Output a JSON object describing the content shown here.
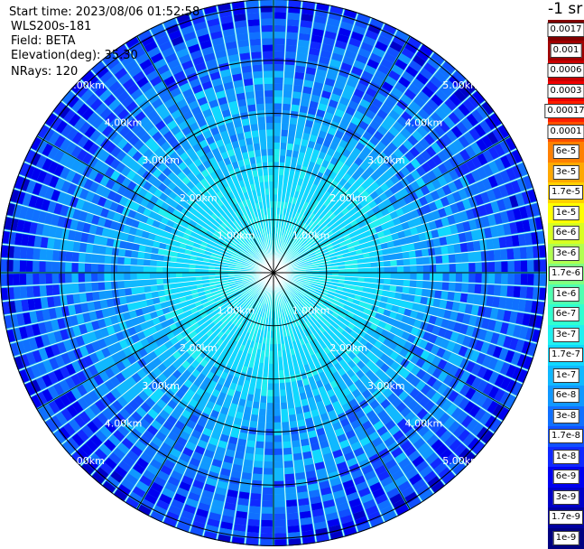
{
  "info": {
    "start_time": "Start time: 2023/08/06 01:52:58",
    "instrument": "WLS200s-181",
    "field": "Field: BETA",
    "elevation": "Elevation(deg): 35.30",
    "nrays": "NRays: 120"
  },
  "chart_data": {
    "type": "heatmap",
    "projection": "polar PPI",
    "field": "BETA",
    "n_rays": 120,
    "elevation_deg": 35.3,
    "range_rings_km": [
      1.0,
      2.0,
      3.0,
      4.0,
      5.0
    ],
    "ring_labels": [
      "1.00km",
      "2.00km",
      "3.00km",
      "4.00km",
      "5.00km"
    ],
    "max_range_km": 5.15,
    "radial_lines_deg": [
      0,
      30,
      60,
      90,
      120,
      150,
      180,
      210,
      240,
      270,
      300,
      330
    ],
    "colorbar": {
      "unit_label": "-1 sr",
      "ticks": [
        "0.0017",
        "0.001",
        "0.0006",
        "0.0003",
        "0.00017",
        "0.0001",
        "6e-5",
        "3e-5",
        "1.7e-5",
        "1e-5",
        "6e-6",
        "3e-6",
        "1.7e-6",
        "1e-6",
        "6e-7",
        "3e-7",
        "1.7e-7",
        "1e-7",
        "6e-8",
        "3e-8",
        "1.7e-8",
        "1e-8",
        "6e-9",
        "3e-9",
        "1.7e-9",
        "1e-9"
      ],
      "colors": [
        "#800000",
        "#a00000",
        "#c80000",
        "#ee0000",
        "#ff1e00",
        "#ff5000",
        "#ff8000",
        "#ffa800",
        "#ffd000",
        "#ffff00",
        "#d8ff20",
        "#b0ff50",
        "#80ff80",
        "#50ffb0",
        "#30ffd0",
        "#20f0f0",
        "#10d8ff",
        "#10b8ff",
        "#1098ff",
        "#1070ff",
        "#1050ff",
        "#1028ff",
        "#0000f0",
        "#0000c8",
        "#0000a0",
        "#000080"
      ]
    },
    "value_profile": [
      {
        "range_km": 0.0,
        "value": "3e-7"
      },
      {
        "range_km": 2.0,
        "value": "1.7e-7"
      },
      {
        "range_km": 3.0,
        "value": "6e-8"
      },
      {
        "range_km": 4.0,
        "value": "3e-8"
      },
      {
        "range_km": 5.0,
        "value": "1e-8"
      }
    ]
  }
}
